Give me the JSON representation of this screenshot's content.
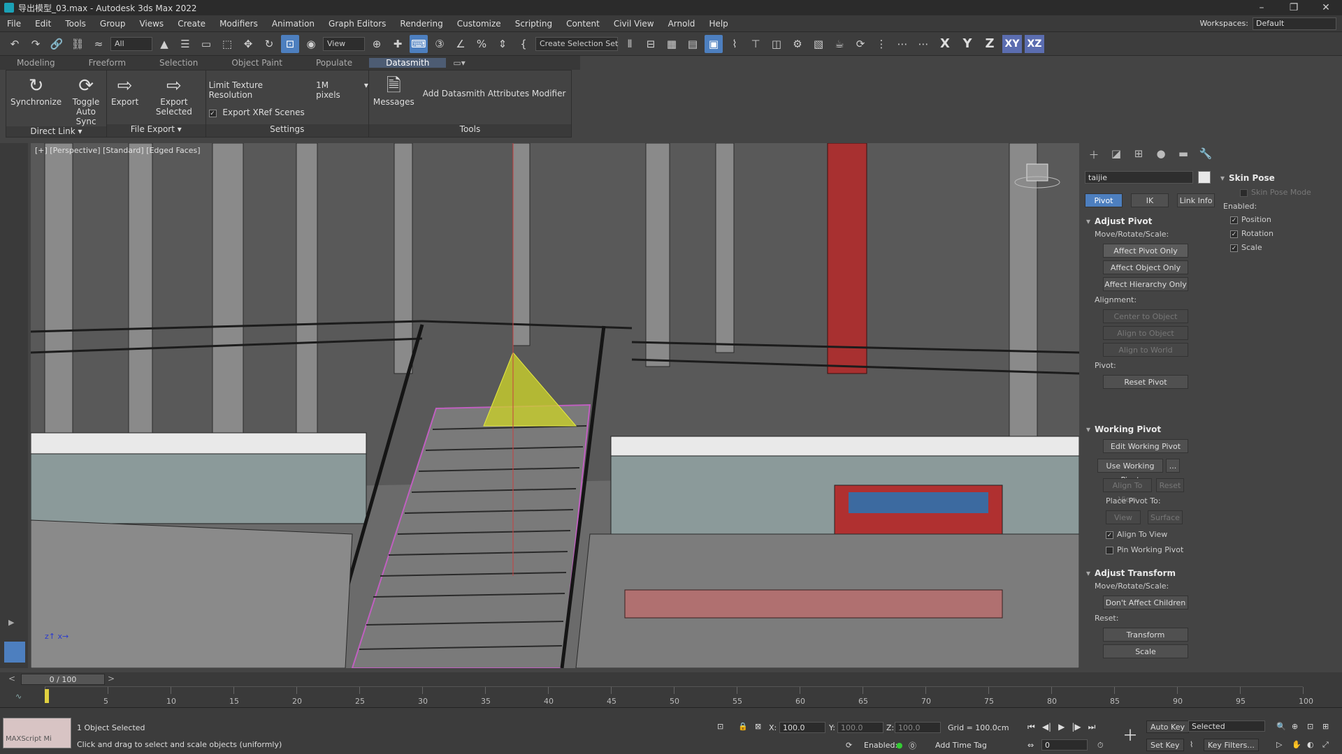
{
  "title": "导出模型_03.max - Autodesk 3ds Max 2022",
  "menu": [
    "File",
    "Edit",
    "Tools",
    "Group",
    "Views",
    "Create",
    "Modifiers",
    "Animation",
    "Graph Editors",
    "Rendering",
    "Customize",
    "Scripting",
    "Content",
    "Civil View",
    "Arnold",
    "Help"
  ],
  "workspaces_label": "Workspaces:",
  "workspace_value": "Default",
  "toolbar": {
    "filter_value": "All",
    "ref_coord": "View",
    "selection_set": "Create Selection Set",
    "axis_x": "X",
    "axis_y": "Y",
    "axis_z": "Z",
    "axis_xy": "XY",
    "axis_xz": "XZ"
  },
  "ribbon_tabs": [
    "Modeling",
    "Freeform",
    "Selection",
    "Object Paint",
    "Populate",
    "Datasmith"
  ],
  "ribbon": {
    "synchronize": "Synchronize",
    "toggle_auto_sync": "Toggle Auto Sync",
    "export": "Export",
    "export_selected": "Export Selected",
    "limit_texture": "Limit Texture Resolution",
    "pixels": "1M pixels",
    "export_xref": "Export XRef Scenes",
    "messages": "Messages",
    "add_attr": "Add Datasmith Attributes Modifier",
    "group_direct_link": "Direct Link",
    "group_file_export": "File Export",
    "group_settings": "Settings",
    "group_tools": "Tools"
  },
  "viewport_label": "[+] [Perspective] [Standard] [Edged Faces]",
  "cmd": {
    "object_name": "taijie",
    "tab_pivot": "Pivot",
    "tab_ik": "IK",
    "tab_link": "Link Info",
    "adjust_pivot": "Adjust Pivot",
    "move_rotate_scale": "Move/Rotate/Scale:",
    "affect_pivot_only": "Affect Pivot Only",
    "affect_object_only": "Affect Object Only",
    "affect_hierarchy_only": "Affect Hierarchy Only",
    "alignment": "Alignment:",
    "center_to_object": "Center to Object",
    "align_to_object": "Align to Object",
    "align_to_world": "Align to World",
    "pivot": "Pivot:",
    "reset_pivot": "Reset Pivot",
    "working_pivot": "Working Pivot",
    "edit_working_pivot": "Edit Working Pivot",
    "use_working_pivot": "Use Working Pivot",
    "ellipsis": "...",
    "align_to_view_btn": "Align To View",
    "reset": "Reset",
    "place_pivot_to": "Place Pivot To:",
    "view": "View",
    "surface": "Surface",
    "align_to_view_chk": "Align To View",
    "pin_working_pivot": "Pin Working Pivot",
    "adjust_transform": "Adjust Transform",
    "move_rotate_scale2": "Move/Rotate/Scale:",
    "dont_affect_children": "Don't Affect Children",
    "reset2": "Reset:",
    "transform": "Transform",
    "scale": "Scale"
  },
  "skin_pose": {
    "title": "Skin Pose",
    "mode": "Skin Pose Mode",
    "enabled": "Enabled:",
    "position": "Position",
    "rotation": "Rotation",
    "scale": "Scale"
  },
  "time": {
    "slider": "0 / 100",
    "ticks": [
      "0",
      "5",
      "10",
      "15",
      "20",
      "25",
      "30",
      "35",
      "40",
      "45",
      "50",
      "55",
      "60",
      "65",
      "70",
      "75",
      "80",
      "85",
      "90",
      "95",
      "100"
    ]
  },
  "status": {
    "maxscript": "MAXScript Mi",
    "selected": "1 Object Selected",
    "prompt": "Click and drag to select and scale objects (uniformly)",
    "x_label": "X:",
    "x_val": "100.0",
    "y_label": "Y:",
    "y_val": "100.0",
    "z_label": "Z:",
    "z_val": "100.0",
    "grid": "Grid = 100.0cm",
    "enabled": "Enabled:",
    "add_time_tag": "Add Time Tag",
    "auto_key": "Auto Key",
    "set_key": "Set Key",
    "selected_dd": "Selected",
    "key_filters": "Key Filters...",
    "frame": "0"
  }
}
